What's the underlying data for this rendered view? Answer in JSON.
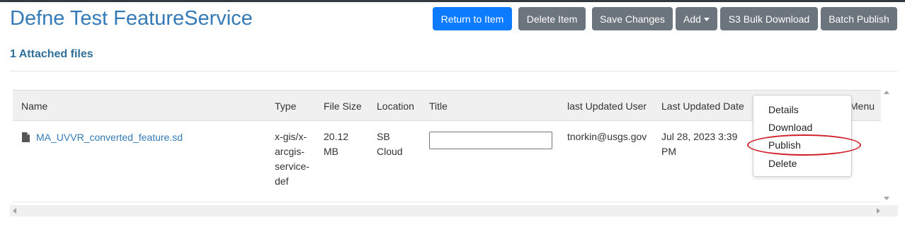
{
  "header": {
    "title": "Defne Test FeatureService",
    "buttons": {
      "return_to_item": "Return to Item",
      "delete_item": "Delete Item",
      "save_changes": "Save Changes",
      "add": "Add",
      "s3_bulk_download": "S3 Bulk Download",
      "batch_publish": "Batch Publish"
    }
  },
  "files_section": {
    "heading": "1 Attached files"
  },
  "table": {
    "columns": {
      "name": "Name",
      "type": "Type",
      "file_size": "File Size",
      "location": "Location",
      "title": "Title",
      "last_updated_user": "last Updated User",
      "last_updated_date": "Last Updated Date",
      "menu": "Menu"
    },
    "rows": [
      {
        "file_icon": "file-icon",
        "name": "MA_UVVR_converted_feature.sd",
        "type": [
          "x-gis/x-",
          "arcgis-",
          "service-",
          "def"
        ],
        "file_size": [
          "20.12",
          "MB"
        ],
        "location": [
          "SB",
          "Cloud"
        ],
        "title_value": "",
        "last_updated_user": "tnorkin@usgs.gov",
        "last_updated_date": [
          "Jul 28, 2023 3:39",
          "PM"
        ]
      }
    ]
  },
  "row_menu": {
    "items": [
      "Details",
      "Download",
      "Publish",
      "Delete"
    ],
    "highlighted_item": "Publish"
  },
  "colors": {
    "primary_button": "#0d7bfd",
    "secondary_button": "#6c757d",
    "title_color": "#337ab7",
    "highlight": "#d0202a"
  }
}
